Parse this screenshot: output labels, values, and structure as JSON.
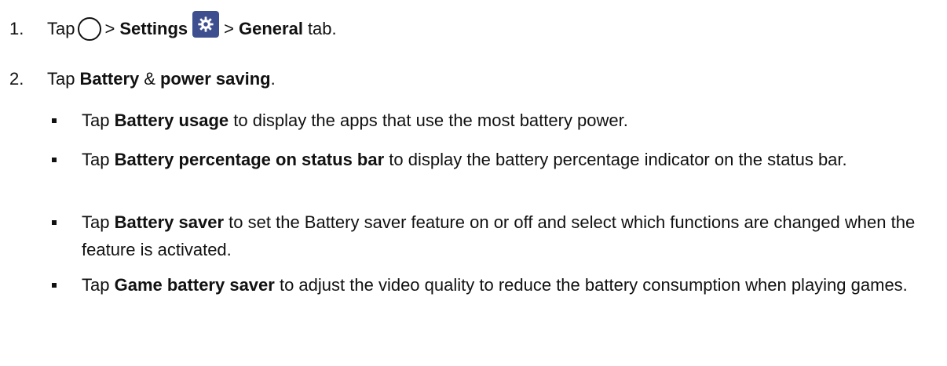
{
  "steps": [
    {
      "number": "1.",
      "part1": "Tap",
      "home_icon": "home-circle-icon",
      "sep1": ">",
      "settings_label": "Settings",
      "settings_icon": "gear-icon",
      "sep2": ">",
      "general_label": "General",
      "tail": "tab."
    },
    {
      "number": "2.",
      "part1": "Tap",
      "bold1": "Battery",
      "amp": "&",
      "bold2": "power saving",
      "tail": "."
    }
  ],
  "bullets": [
    {
      "tap": "Tap",
      "bold": "Battery usage",
      "rest": "to display the apps that use the most battery power."
    },
    {
      "tap": "Tap",
      "bold": "Battery percentage on status bar",
      "rest": "to display the battery percentage indicator on the status bar."
    },
    {
      "tap": "Tap",
      "bold": "Battery saver",
      "rest": "to set the Battery saver feature on or off and select which functions are changed when the feature is activated."
    },
    {
      "tap": "Tap",
      "bold": "Game battery saver",
      "rest": "to adjust the video quality to reduce the battery consumption when playing games."
    }
  ],
  "colors": {
    "settings_icon_bg": "#3d4f8f",
    "text": "#111111"
  }
}
